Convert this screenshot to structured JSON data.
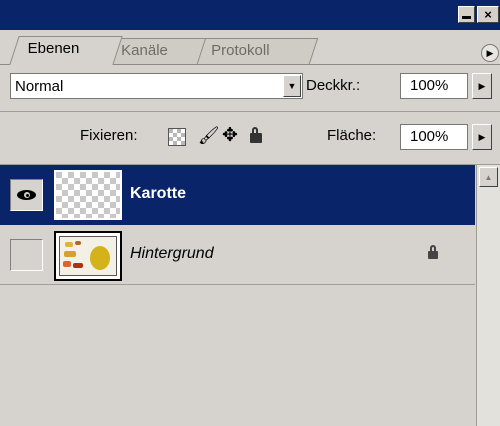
{
  "titlebar": {
    "minimize_icon": "minimize-icon",
    "close_label": "×"
  },
  "tabs": [
    {
      "label": "Ebenen",
      "active": true
    },
    {
      "label": "Kanäle",
      "active": false
    },
    {
      "label": "Protokoll",
      "active": false
    }
  ],
  "panel_menu_icon": "▶",
  "blend": {
    "mode": "Normal"
  },
  "opacity": {
    "label": "Deckkr.:",
    "value": "100%"
  },
  "lock": {
    "label": "Fixieren:"
  },
  "fill": {
    "label": "Fläche:",
    "value": "100%"
  },
  "layers": [
    {
      "name": "Karotte",
      "visible": true,
      "selected": true,
      "locked": false
    },
    {
      "name": "Hintergrund",
      "visible": false,
      "selected": false,
      "locked": true
    }
  ],
  "colors": {
    "titlebar": "#0a246a",
    "selection": "#0a246a",
    "panel_bg": "#d6d3ce"
  }
}
